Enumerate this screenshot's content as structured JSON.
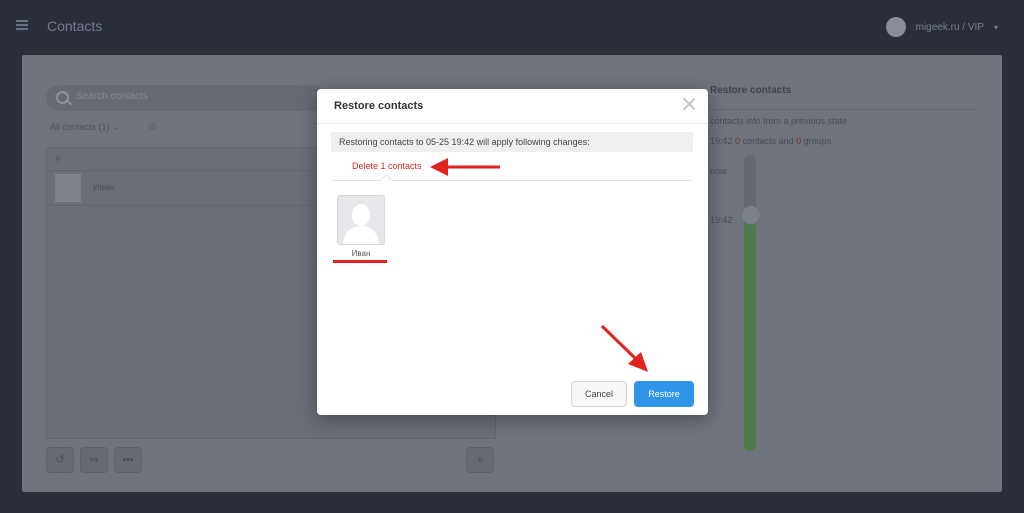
{
  "header": {
    "title": "Contacts",
    "account_name": "migeek.ru / VIP",
    "caret": "▾"
  },
  "contacts_panel": {
    "search_placeholder": "Search contacts",
    "filter_label": "All contacts (1) ⌄",
    "filter_gear": "⚙",
    "column_header": "#",
    "rows": [
      {
        "name": "Иван"
      }
    ],
    "toolbar": {
      "history_icon": "↺",
      "merge_icon": "↣",
      "more_icon": "•••",
      "add_icon": "+"
    }
  },
  "restore_panel": {
    "title": "Restore contacts",
    "description": "contacts info from a previous state",
    "summary_time": "19:42",
    "summary_contacts_count": "0",
    "summary_contacts_word": "contacts and",
    "summary_groups_count": "0",
    "summary_groups_word": "groups",
    "label_now": "now",
    "label_time": "19:42",
    "slider_level": 0.8
  },
  "dialog": {
    "title": "Restore contacts",
    "info": "Restoring contacts to 05-25 19:42 will apply following changes:",
    "tab_label": "Delete 1 contacts",
    "contacts": [
      {
        "name": "Иван"
      }
    ],
    "cancel_label": "Cancel",
    "restore_label": "Restore"
  },
  "colors": {
    "accent_blue": "#2e95e9",
    "delete_red": "#d7261e",
    "annotation_red": "#e1241b"
  }
}
